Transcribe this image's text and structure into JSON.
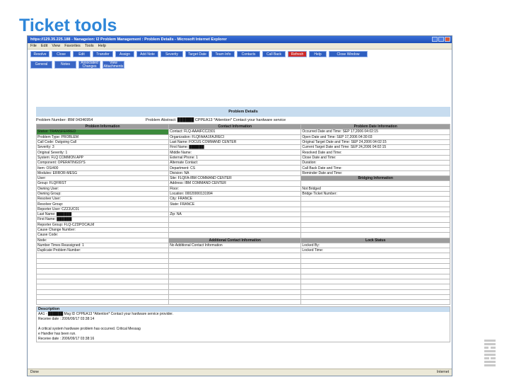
{
  "slide": {
    "title": "Ticket tools"
  },
  "window": {
    "title": "https://129.35.225.188 - Nanageion: I2 Problem Management : Problem Details - Microsoft Internet Explorer"
  },
  "menu": [
    "File",
    "Edit",
    "View",
    "Favorites",
    "Tools",
    "Help"
  ],
  "toolbar": [
    {
      "label": "Resolve",
      "accent": "#2f5fc0"
    },
    {
      "label": "Close",
      "accent": "#2f5fc0"
    },
    {
      "label": "Edit",
      "accent": "#2f5fc0"
    },
    {
      "label": "Transfer",
      "accent": "#2f5fc0"
    },
    {
      "label": "Assign",
      "accent": "#2f5fc0"
    },
    {
      "label": "Add Note",
      "accent": "#2f5fc0"
    },
    {
      "label": "Severity",
      "accent": "#2f5fc0"
    },
    {
      "label": "Target Date",
      "accent": "#2f5fc0"
    },
    {
      "label": "Team Info",
      "accent": "#2f5fc0"
    },
    {
      "label": "Contacts",
      "accent": "#2f5fc0"
    },
    {
      "label": "Call Back",
      "accent": "#2f5fc0"
    },
    {
      "label": "Refresh",
      "accent": "#cc2a2a"
    },
    {
      "label": "Help",
      "accent": "#2f5fc0"
    },
    {
      "label": "Close Window",
      "accent": "#2f5fc0"
    }
  ],
  "tabs": [
    "General",
    "Notes",
    "Associated Changes",
    "View Attachments"
  ],
  "details": {
    "header": "Problem Details",
    "problem_number": "Problem Number: IBM 04346954",
    "problem_abstract": "Problem Abstract: ██████ CPPEA13 *Attention* Contact your hardware service",
    "col_headers": [
      "Problem Information",
      "Contact Information",
      "Problem Date Information"
    ],
    "rows": [
      [
        "Status: TRANSFERRED",
        "Contact: FLQ-AAAIFCC2301",
        "Occurred Date and Time: SEP 17,2006 04:02:15"
      ],
      [
        "Problem Type: PROBLEM",
        "Organization: FLQFAAA1FAJRECI",
        "Open Date and Time: SEP 17,2006 04:30:03"
      ],
      [
        "Call Code: Outgoing Call",
        "Last Name: FOCUS COMMAND CENTER",
        "Original Target Date and Time: SEP 24,2006 04:02:15"
      ],
      [
        "Severity: 3",
        "First Name: ██████",
        "Current Target Date and Time: SEP 24,2006 04:02:15"
      ],
      [
        "Original Severity: 1",
        "Middle Name:",
        "Resolved Date and Time:"
      ],
      [
        "System: FLQ COMMON APP",
        "External Phone: 1",
        "Close Date and Time:"
      ],
      [
        "Component: OPERATINGSYS",
        "Alternate Contact:",
        "Duration:"
      ],
      [
        "Item: OS/400",
        "Department: CS",
        "Call Back Date and Time:"
      ],
      [
        "Modules: ERROR-MESG",
        "Division: NA",
        "Reminder Date and Time:"
      ],
      [
        "User:",
        "Site: FLQFA-IBM COMMAND CENTER",
        "Bridging Information"
      ],
      [
        "Group: FLQFRIST",
        "Address: IBM COMMAND CENTER",
        ""
      ],
      [
        "Owning User:",
        "Floor:",
        "Not Bridged"
      ],
      [
        "Owning Group:",
        "Location: 00020000131994",
        "Bridge Ticket Number:"
      ],
      [
        "Resolver User:",
        "City: FRANCE",
        ""
      ],
      [
        "Resolver Group:",
        "State: FRANCE",
        ""
      ],
      [
        "Reporter User: CZZJUC01",
        "",
        ""
      ],
      [
        "Last Name: ██████",
        "Zip: NA",
        ""
      ],
      [
        "First Name: ██████",
        "",
        ""
      ],
      [
        "Reporter Group: FLQ-CZDPOCALM",
        "",
        ""
      ],
      [
        "Cause Change Number:",
        "",
        ""
      ],
      [
        "Cause Code:",
        "",
        ""
      ],
      [
        "Node:",
        "Additional Contact Information",
        "Lock Status"
      ],
      [
        "Number Times Reassigned: 1",
        "No Additional Contact Information",
        "Locked By:"
      ],
      [
        "Duplicate Problem Number:",
        "",
        "Locked Time:"
      ],
      [
        "",
        "",
        ""
      ],
      [
        "",
        "",
        ""
      ],
      [
        "",
        "",
        ""
      ],
      [
        "",
        "",
        ""
      ],
      [
        "",
        "",
        ""
      ],
      [
        "",
        "",
        ""
      ],
      [
        "",
        "",
        ""
      ],
      [
        "",
        "",
        ""
      ],
      [
        "",
        "",
        ""
      ],
      [
        "",
        "",
        ""
      ]
    ],
    "description": {
      "header": "Description",
      "lines": [
        "AA1 - ██████ Msg ID CPPEA13 *Attention* Contact your hardware service provider.",
        "Receive date : 2006/09/17 03:38:14",
        "",
        "A critical system hardware problem has occurred. Critical Messag",
        "e Handler has been run.",
        "Receive date : 2006/09/17 03:38:16"
      ]
    }
  },
  "status": {
    "left": "Done",
    "right": "Internet"
  }
}
